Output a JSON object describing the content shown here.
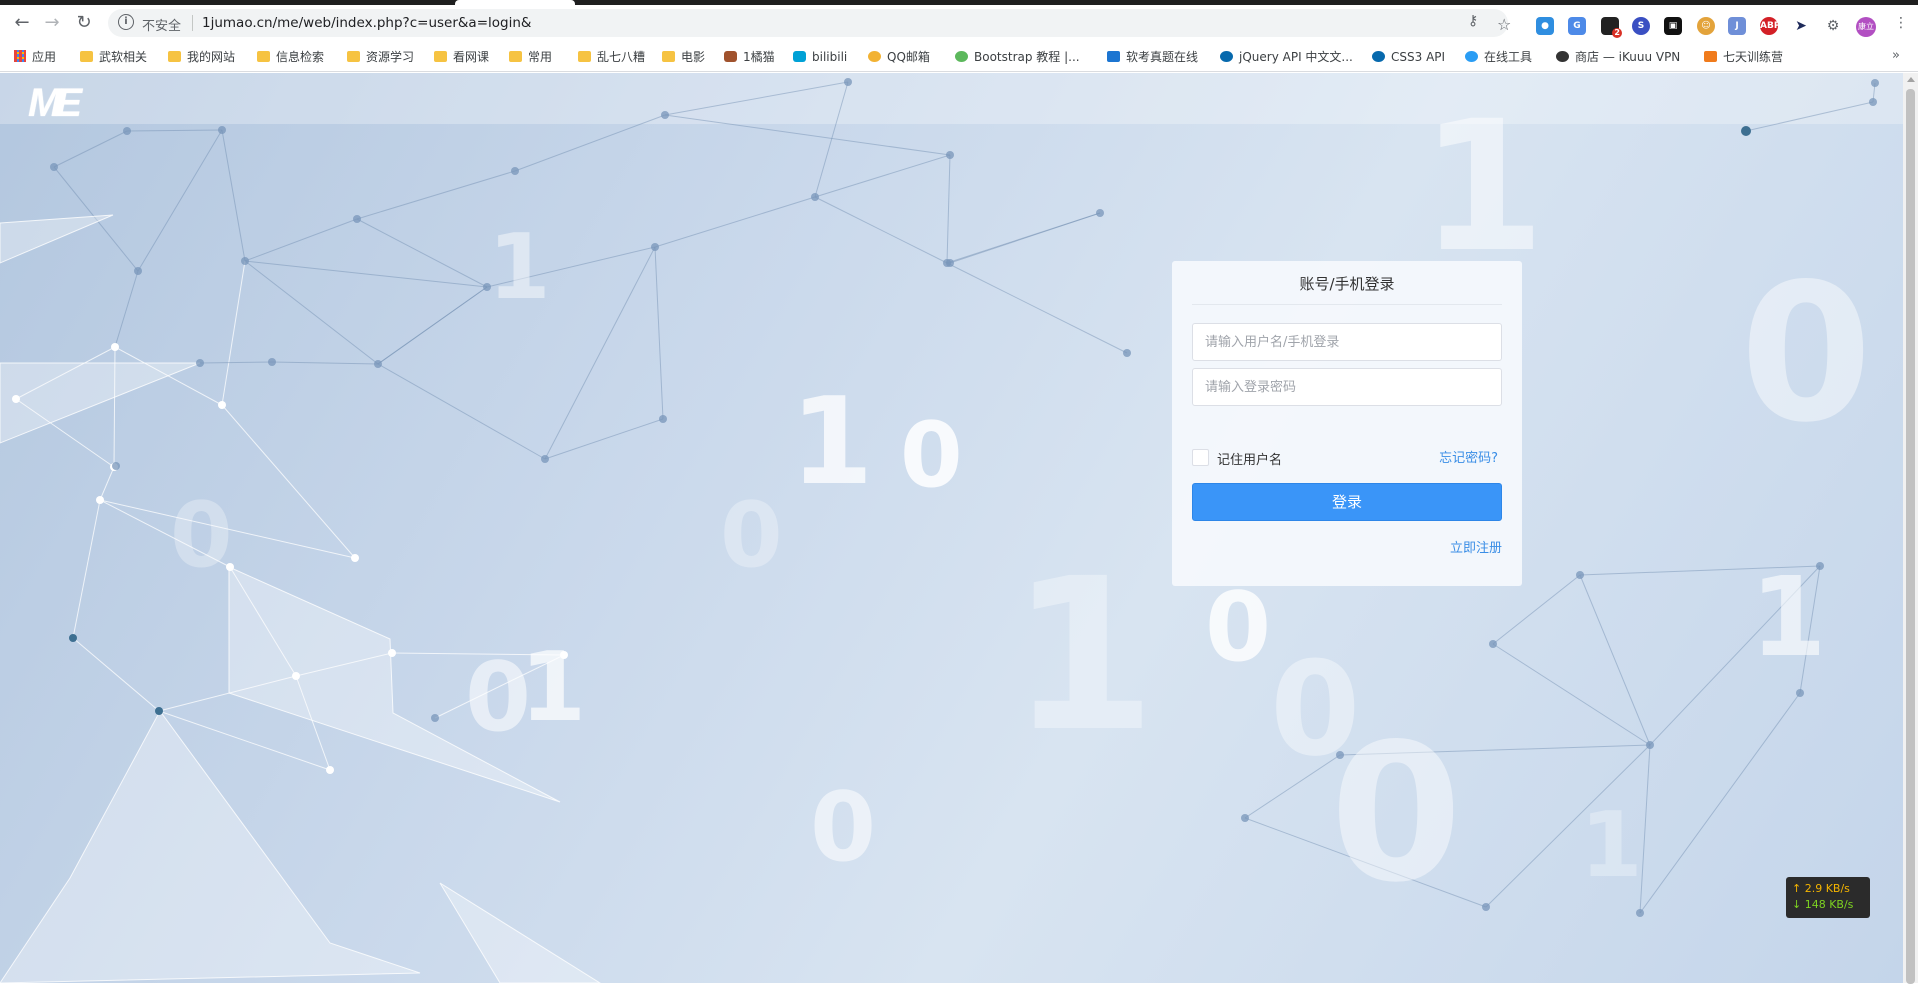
{
  "browser": {
    "address": {
      "security_label": "不安全",
      "url": "1jumao.cn/me/web/index.php?c=user&a=login&"
    },
    "profile_initials": "康立",
    "extension_badge": "2",
    "bookmarks": [
      {
        "label": "应用",
        "icon": "apps-grid-icon"
      },
      {
        "label": "武软相关",
        "icon": "folder-icon"
      },
      {
        "label": "我的网站",
        "icon": "folder-icon"
      },
      {
        "label": "信息检索",
        "icon": "folder-icon"
      },
      {
        "label": "资源学习",
        "icon": "folder-icon"
      },
      {
        "label": "看网课",
        "icon": "folder-icon"
      },
      {
        "label": "常用",
        "icon": "folder-icon"
      },
      {
        "label": "乱七八糟",
        "icon": "folder-icon"
      },
      {
        "label": "电影",
        "icon": "folder-icon"
      },
      {
        "label": "1橘猫",
        "icon": "cat-icon"
      },
      {
        "label": "bilibili",
        "icon": "bilibili-icon"
      },
      {
        "label": "QQ邮箱",
        "icon": "qq-mail-icon"
      },
      {
        "label": "Bootstrap 教程 |...",
        "icon": "bootstrap-icon"
      },
      {
        "label": "软考真题在线",
        "icon": "ie-icon"
      },
      {
        "label": "jQuery API 中文文...",
        "icon": "jquery-icon"
      },
      {
        "label": "CSS3 API",
        "icon": "jquery-icon"
      },
      {
        "label": "在线工具",
        "icon": "c-icon"
      },
      {
        "label": "商店 — iKuuu VPN",
        "icon": "cat-face-icon"
      },
      {
        "label": "七天训练营",
        "icon": "brackets-icon"
      }
    ]
  },
  "page": {
    "logo_text": "ME",
    "background_digits": [
      "1",
      "1",
      "0",
      "0",
      "1",
      "0",
      "0",
      "0",
      "1",
      "0",
      "1",
      "0",
      "1",
      "0",
      "0",
      "1",
      "0",
      "1"
    ]
  },
  "login": {
    "title": "账号/手机登录",
    "username_placeholder": "请输入用户名/手机登录",
    "password_placeholder": "请输入登录密码",
    "remember_label": "记住用户名",
    "forgot_label": "忘记密码?",
    "submit_label": "登录",
    "register_label": "立即注册",
    "accent_color": "#3a95f8"
  },
  "netspeed": {
    "upload": "↑ 2.9 KB/s",
    "download": "↓ 148 KB/s"
  }
}
